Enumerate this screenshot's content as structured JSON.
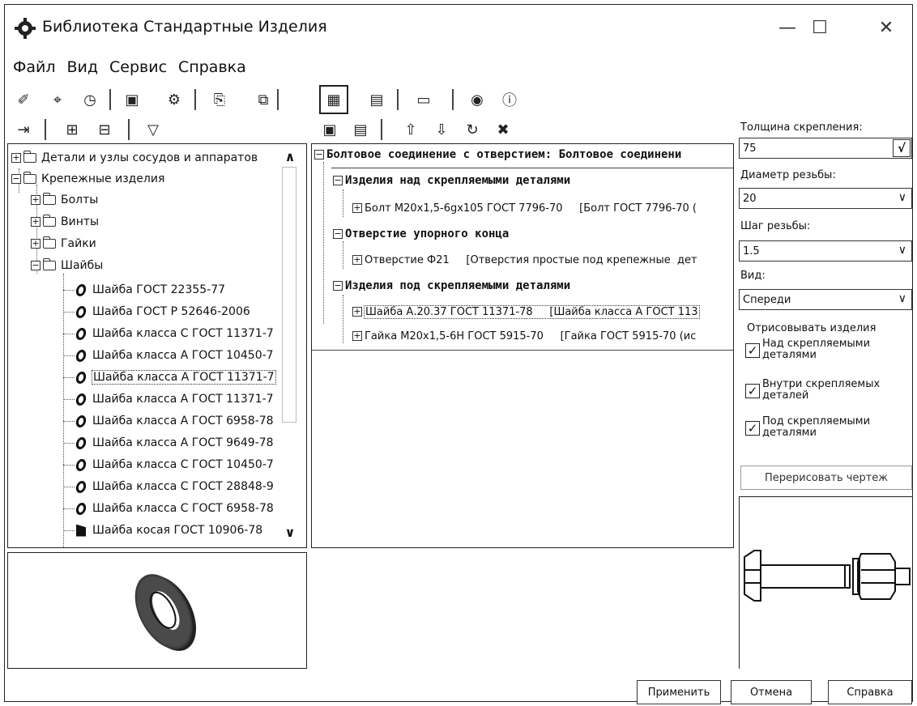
{
  "window": {
    "title": "Библиотека Стандартные Изделия",
    "minimize_glyph": "—",
    "maximize_glyph": "☐",
    "close_glyph": "✕"
  },
  "menu": [
    "Файл",
    "Вид",
    "Сервис",
    "Справка"
  ],
  "left_tree": {
    "items": [
      "Детали и узлы сосудов и аппаратов",
      "Крепежные изделия",
      "Болты",
      "Винты",
      "Гайки",
      "Шайбы",
      "Шайба ГОСТ 22355-77",
      "Шайба ГОСТ Р 52646-2006",
      "Шайба класса С ГОСТ 11371-7",
      "Шайба класса А ГОСТ 10450-7",
      "Шайба класса А ГОСТ 11371-7",
      "Шайба класса А ГОСТ 11371-7",
      "Шайба класса А ГОСТ 6958-78",
      "Шайба класса А ГОСТ 9649-78",
      "Шайба класса С ГОСТ 10450-7",
      "Шайба класса С ГОСТ 28848-9",
      "Шайба класса С ГОСТ 6958-78",
      "Шайба косая ГОСТ 10906-78"
    ],
    "scroll_up": "∧",
    "scroll_down": "∨"
  },
  "middle_tree": {
    "root": "Болтовое соединение с отверстием: Болтовое соединени",
    "groups": [
      {
        "label": "Изделия над скрепляемыми деталями",
        "items": [
          "Болт М20х1,5-6gх105 ГОСТ 7796-70     [Болт ГОСТ 7796-70 ("
        ]
      },
      {
        "label": "Отверстие упорного конца",
        "items": [
          "Отверстие Ф21     [Отверстия простые под крепежные  дет"
        ]
      },
      {
        "label": "Изделия под скрепляемыми деталями",
        "items": [
          "Шайба А.20.37 ГОСТ 11371-78     [Шайба класса А ГОСТ 113",
          "Гайка М20х1,5-6Н ГОСТ 5915-70     [Гайка ГОСТ 5915-70 (ис"
        ]
      }
    ]
  },
  "params": {
    "thickness_label": "Толщина скрепления:",
    "thickness_value": "75",
    "thickness_confirm": "√",
    "diameter_label": "Диаметр резьбы:",
    "diameter_value": "20",
    "pitch_label": "Шаг резьбы:",
    "pitch_value": "1.5",
    "view_label": "Вид:",
    "view_value": "Спереди",
    "draw_group_label": "Отрисовывать изделия",
    "cb_above": "Над скрепляемыми деталями",
    "cb_inside": "Внутри скрепляемых деталей",
    "cb_below": "Под скрепляемыми деталями",
    "check_glyph": "✓",
    "redraw_button": "Перерисовать чертеж"
  },
  "footer": {
    "apply": "Применить",
    "cancel": "Отмена",
    "help": "Справка"
  },
  "colors": {
    "border": "#222222",
    "text": "#111111",
    "background": "#ffffff"
  }
}
